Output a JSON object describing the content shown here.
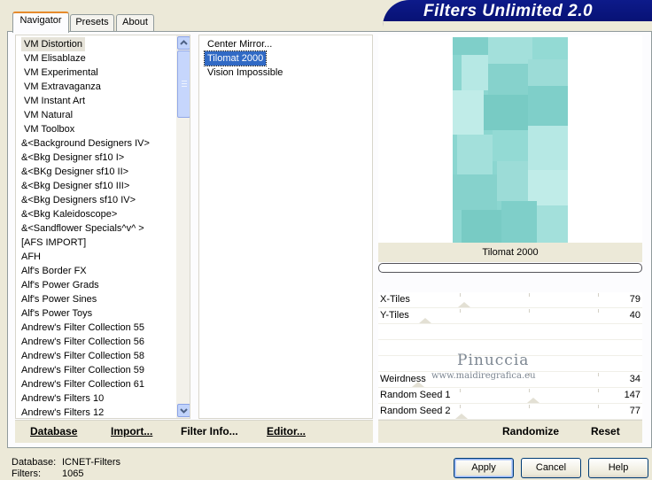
{
  "title": "Filters Unlimited 2.0",
  "tabs": [
    "Navigator",
    "Presets",
    "About"
  ],
  "categories": [
    "VM Distortion",
    "VM Elisablaze",
    "VM Experimental",
    "VM Extravaganza",
    "VM Instant Art",
    "VM Natural",
    "VM Toolbox",
    "&<Background Designers IV>",
    "&<Bkg Designer sf10 I>",
    "&<BKg Designer sf10 II>",
    "&<Bkg Designer sf10 III>",
    "&<Bkg Designers sf10 IV>",
    "&<Bkg Kaleidoscope>",
    "&<Sandflower Specials^v^ >",
    "[AFS IMPORT]",
    "AFH",
    "Alf's Border FX",
    "Alf's Power Grads",
    "Alf's Power Sines",
    "Alf's Power Toys",
    "Andrew's Filter Collection 55",
    "Andrew's Filter Collection 56",
    "Andrew's Filter Collection 58",
    "Andrew's Filter Collection 59",
    "Andrew's Filter Collection 61",
    "Andrew's Filters 10",
    "Andrew's Filters 12"
  ],
  "selected_category": "VM Distortion",
  "filters": [
    "Center Mirror...",
    "Tilomat 2000",
    "Vision Impossible"
  ],
  "selected_filter": "Tilomat 2000",
  "left_actions": {
    "database": "Database",
    "import": "Import...",
    "filter_info": "Filter Info...",
    "editor": "Editor..."
  },
  "preview_caption": "Tilomat 2000",
  "progress": 0,
  "params": [
    {
      "label": "X-Tiles",
      "value": "79",
      "level": 0.31
    },
    {
      "label": "Y-Tiles",
      "value": "40",
      "level": 0.16
    },
    {
      "label": "",
      "value": ""
    },
    {
      "label": "",
      "value": ""
    },
    {
      "label": "",
      "value": ""
    },
    {
      "label": "Weirdness",
      "value": "34",
      "level": 0.13
    },
    {
      "label": "Random Seed 1",
      "value": "147",
      "level": 0.58
    },
    {
      "label": "Random Seed 2",
      "value": "77",
      "level": 0.3
    }
  ],
  "right_actions": {
    "randomize": "Randomize",
    "reset": "Reset"
  },
  "watermark": {
    "name": "Pinuccia",
    "url": "www.maidiregrafica.eu"
  },
  "footer": {
    "database_label": "Database:",
    "database_value": "ICNET-Filters",
    "filters_label": "Filters:",
    "filters_value": "1065"
  },
  "buttons": {
    "apply": "Apply",
    "cancel": "Cancel",
    "help": "Help"
  },
  "colors": {
    "accent": "#e68b2c",
    "selection": "#316ac5",
    "banner": "#0d1a8a",
    "tile": "#8bd6d0"
  },
  "icons": {
    "scroll_up": "chevron-up-icon",
    "scroll_down": "chevron-down-icon"
  }
}
